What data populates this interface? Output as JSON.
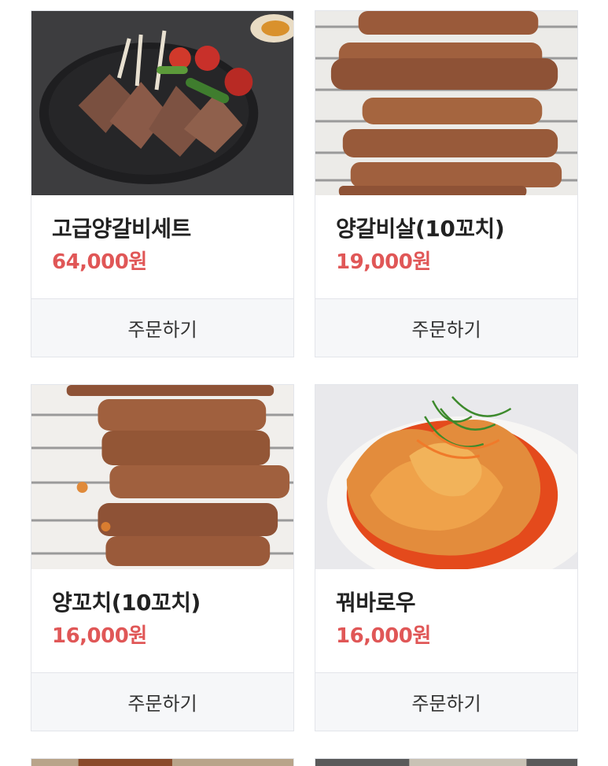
{
  "products": [
    {
      "name": "고급양갈비세트",
      "price": "64,000원",
      "order_label": "주문하기"
    },
    {
      "name": "양갈비살(10꼬치)",
      "price": "19,000원",
      "order_label": "주문하기"
    },
    {
      "name": "양꼬치(10꼬치)",
      "price": "16,000원",
      "order_label": "주문하기"
    },
    {
      "name": "꿔바로우",
      "price": "16,000원",
      "order_label": "주문하기"
    }
  ]
}
